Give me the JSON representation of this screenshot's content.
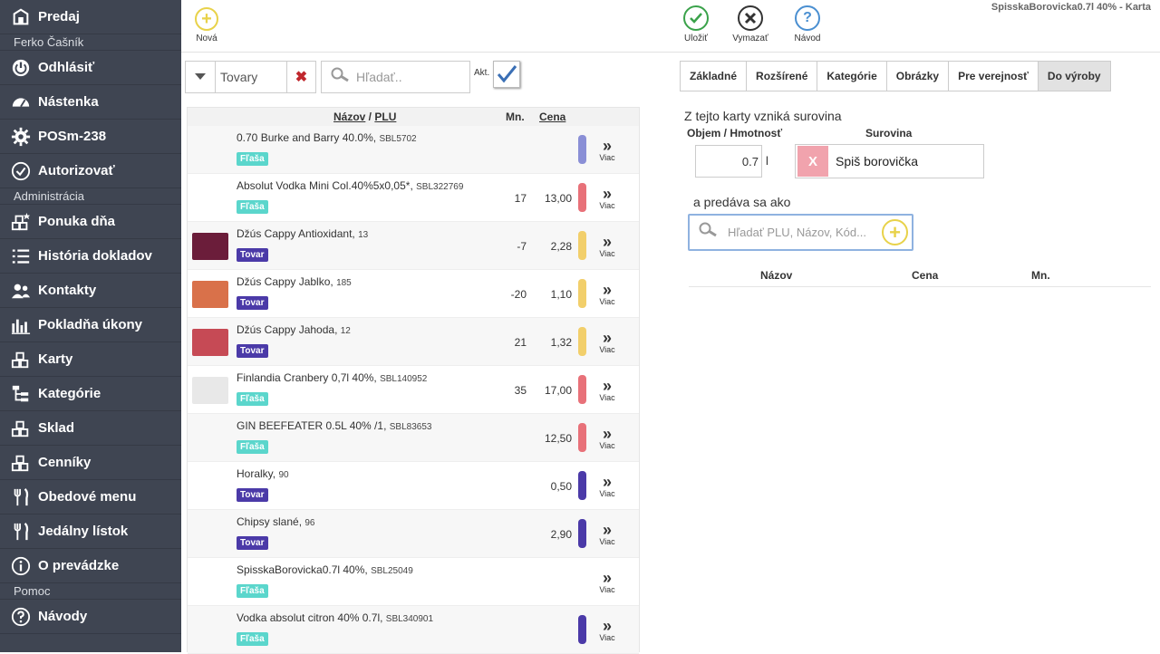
{
  "window_title": "SpisskaBorovicka0.7l 40% - Karta",
  "sidebar": {
    "top_item": "Predaj",
    "user_section": "Ferko Čašník",
    "user_items": [
      {
        "label": "Odhlásiť",
        "icon": "power-icon"
      },
      {
        "label": "Nástenka",
        "icon": "dashboard-icon"
      },
      {
        "label": "POSm-238",
        "icon": "gear-icon"
      },
      {
        "label": "Autorizovať",
        "icon": "check-circle-icon"
      }
    ],
    "admin_section": "Administrácia",
    "admin_items": [
      {
        "label": "Ponuka dňa",
        "icon": "star-blocks-icon"
      },
      {
        "label": "História dokladov",
        "icon": "list-icon"
      },
      {
        "label": "Kontakty",
        "icon": "users-icon"
      },
      {
        "label": "Pokladňa úkony",
        "icon": "bar-chart-icon"
      },
      {
        "label": "Karty",
        "icon": "blocks-icon"
      },
      {
        "label": "Kategórie",
        "icon": "tree-icon"
      },
      {
        "label": "Sklad",
        "icon": "blocks-icon"
      },
      {
        "label": "Cenníky",
        "icon": "blocks-icon"
      },
      {
        "label": "Obedové menu",
        "icon": "cutlery-icon"
      },
      {
        "label": "Jedálny lístok",
        "icon": "cutlery-icon"
      },
      {
        "label": "O prevádzke",
        "icon": "info-icon"
      }
    ],
    "help_section": "Pomoc",
    "help_items": [
      {
        "label": "Návody",
        "icon": "help-icon"
      }
    ]
  },
  "toolbar": {
    "new_label": "Nová",
    "save_label": "Uložiť",
    "delete_label": "Vymazať",
    "guide_label": "Návod"
  },
  "filter": {
    "type_value": "Tovary",
    "search_placeholder": "Hľadať..",
    "active_label": "Akt."
  },
  "list": {
    "header": {
      "name": "Názov",
      "sep": " / ",
      "plu": "PLU",
      "qty": "Mn.",
      "price": "Cena"
    },
    "more_label": "Viac",
    "rows": [
      {
        "name": "0.70 Burke and Barry 40.0%",
        "plu": "SBL5702",
        "badge": "Fľaša",
        "qty": "",
        "price": "",
        "bar_color": "#8a8fd6",
        "thumb": ""
      },
      {
        "name": "Absolut Vodka Mini Col.40%5x0,05*",
        "plu": "SBL322769",
        "badge": "Fľaša",
        "qty": "17",
        "price": "13,00",
        "bar_color": "#e87179",
        "thumb": ""
      },
      {
        "name": "Džús Cappy Antioxidant",
        "plu": "13",
        "badge": "Tovar",
        "qty": "-7",
        "price": "2,28",
        "bar_color": "#f2cf6b",
        "thumb": "#6b1d3a"
      },
      {
        "name": "Džús Cappy Jablko",
        "plu": "185",
        "badge": "Tovar",
        "qty": "-20",
        "price": "1,10",
        "bar_color": "#f2cf6b",
        "thumb": "#d9714a"
      },
      {
        "name": "Džús Cappy Jahoda",
        "plu": "12",
        "badge": "Tovar",
        "qty": "21",
        "price": "1,32",
        "bar_color": "#f2cf6b",
        "thumb": "#c64a55"
      },
      {
        "name": "Finlandia Cranbery 0,7l 40%",
        "plu": "SBL140952",
        "badge": "Fľaša",
        "qty": "35",
        "price": "17,00",
        "bar_color": "#e87179",
        "thumb": "#e8e8e8"
      },
      {
        "name": "GIN BEEFEATER 0.5L 40% /1",
        "plu": "SBL83653",
        "badge": "Fľaša",
        "qty": "",
        "price": "12,50",
        "bar_color": "#e87179",
        "thumb": ""
      },
      {
        "name": "Horalky",
        "plu": "90",
        "badge": "Tovar",
        "qty": "",
        "price": "0,50",
        "bar_color": "#4b3aa8",
        "thumb": ""
      },
      {
        "name": "Chipsy slané",
        "plu": "96",
        "badge": "Tovar",
        "qty": "",
        "price": "2,90",
        "bar_color": "#4b3aa8",
        "thumb": ""
      },
      {
        "name": "SpisskaBorovicka0.7l 40%",
        "plu": "SBL25049",
        "badge": "Fľaša",
        "qty": "",
        "price": "",
        "bar_color": "",
        "thumb": ""
      },
      {
        "name": "Vodka absolut citron 40% 0.7l",
        "plu": "SBL340901",
        "badge": "Fľaša",
        "qty": "",
        "price": "",
        "bar_color": "#4b3aa8",
        "thumb": ""
      }
    ]
  },
  "tabs": [
    "Základné",
    "Rozšírené",
    "Kategórie",
    "Obrázky",
    "Pre verejnosť",
    "Do výroby"
  ],
  "active_tab": "Do výroby",
  "production": {
    "intro": "Z tejto karty vzniká surovina",
    "qty_header": "Objem / Hmotnosť",
    "ingredient_header": "Surovina",
    "qty_value": "0.7",
    "unit": "l",
    "remove_label": "X",
    "ingredient_name": "Spiš borovička",
    "sold_as": "a predáva sa ako",
    "search_placeholder": "Hľadať PLU, Názov, Kód...",
    "table_headers": {
      "name": "Názov",
      "price": "Cena",
      "qty": "Mn."
    }
  }
}
